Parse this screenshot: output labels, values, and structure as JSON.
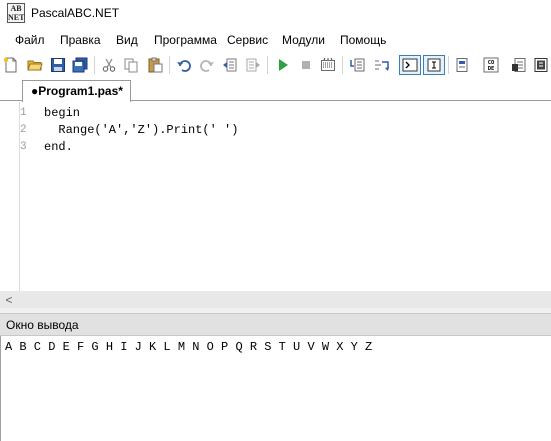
{
  "window": {
    "title": "PascalABC.NET",
    "icon_letters": [
      "AB",
      "NET"
    ]
  },
  "menu": [
    "Файл",
    "Правка",
    "Вид",
    "Программа",
    "Сервис",
    "Модули",
    "Помощь"
  ],
  "toolbar": {
    "buttons": [
      {
        "name": "new-file",
        "icon": "new-file-icon"
      },
      {
        "name": "open",
        "icon": "folder-open-icon"
      },
      {
        "name": "save",
        "icon": "save-icon"
      },
      {
        "name": "save-all",
        "icon": "save-all-icon"
      },
      {
        "name": "cut",
        "icon": "scissors-icon"
      },
      {
        "name": "copy",
        "icon": "copy-icon"
      },
      {
        "name": "paste",
        "icon": "paste-icon"
      },
      {
        "name": "undo",
        "icon": "undo-icon"
      },
      {
        "name": "redo",
        "icon": "redo-icon"
      },
      {
        "name": "outdent",
        "icon": "outdent-icon"
      },
      {
        "name": "indent",
        "icon": "indent-icon"
      },
      {
        "name": "run",
        "icon": "play-icon"
      },
      {
        "name": "stop",
        "icon": "stop-icon"
      },
      {
        "name": "compile",
        "icon": "compile-icon"
      },
      {
        "name": "step-into",
        "icon": "step-into-icon"
      },
      {
        "name": "step-over",
        "icon": "step-over-icon"
      },
      {
        "name": "console-output",
        "icon": "console-icon",
        "active": true
      },
      {
        "name": "text-output",
        "icon": "text-output-icon",
        "active": true
      },
      {
        "name": "form-designer",
        "icon": "form-icon"
      },
      {
        "name": "code-template",
        "icon": "code-icon"
      },
      {
        "name": "ide-settings",
        "icon": "settings-doc-icon"
      },
      {
        "name": "help",
        "icon": "help-book-icon"
      }
    ],
    "code_icon_text": "CO\nDE"
  },
  "tabs": [
    {
      "label": "●Program1.pas*",
      "active": true
    }
  ],
  "editor": {
    "lines": [
      {
        "number": "1",
        "text": "begin"
      },
      {
        "number": "2",
        "text": "  Range('A','Z').Print(' ')"
      },
      {
        "number": "3",
        "text": "end."
      }
    ]
  },
  "scrollbar": {
    "left_arrow": "<"
  },
  "output": {
    "title": "Окно вывода",
    "text": "A B C D E F G H I J K L M N O P Q R S T U V W X Y Z"
  }
}
